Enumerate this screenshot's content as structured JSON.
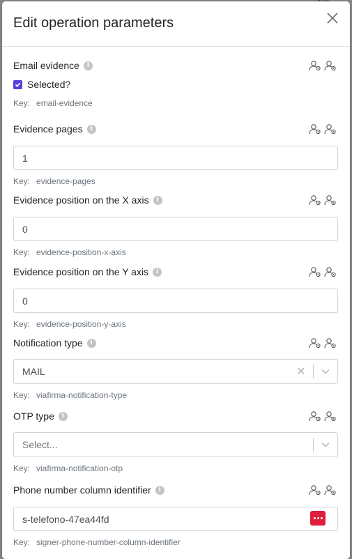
{
  "modal": {
    "title": "Edit operation parameters"
  },
  "key_prefix": "Key:",
  "fields": [
    {
      "label": "Email evidence",
      "checkbox_label": "Selected?",
      "key": "email-evidence"
    },
    {
      "label": "Evidence pages",
      "value": "1",
      "key": "evidence-pages"
    },
    {
      "label": "Evidence position on the X axis",
      "value": "0",
      "key": "evidence-position-x-axis"
    },
    {
      "label": "Evidence position on the Y axis",
      "value": "0",
      "key": "evidence-position-y-axis"
    },
    {
      "label": "Notification type",
      "value": "MAIL",
      "key": "viafirma-notification-type"
    },
    {
      "label": "OTP type",
      "placeholder": "Select...",
      "key": "viafirma-notification-otp"
    },
    {
      "label": "Phone number column identifier",
      "value": "s-telefono-47ea44fd",
      "key": "signer-phone-number-column-identifier"
    }
  ],
  "colors": {
    "checkbox": "#5b3fd6",
    "dots_button": "#e01d3c"
  }
}
